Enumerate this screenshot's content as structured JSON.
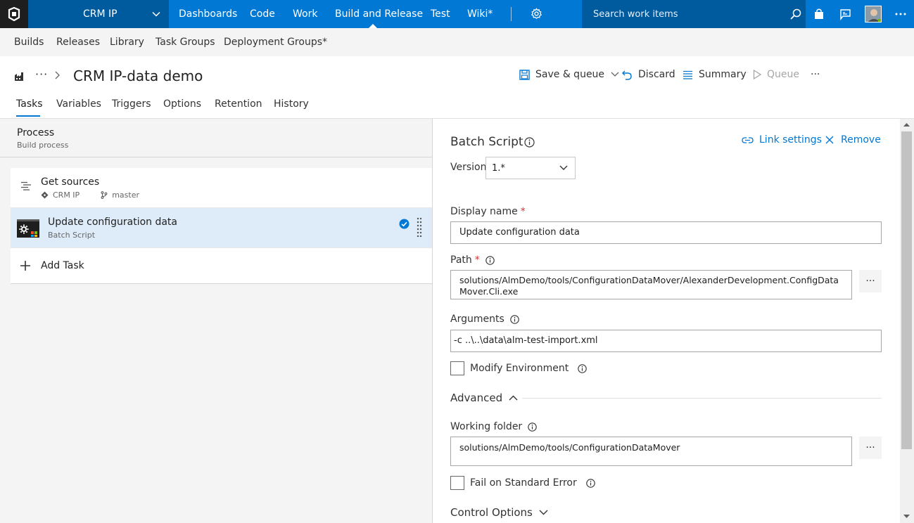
{
  "topbar": {
    "project": "CRM IP",
    "nav": [
      "Dashboards",
      "Code",
      "Work",
      "Build and Release",
      "Test",
      "Wiki*"
    ],
    "active_nav": "Build and Release",
    "search_placeholder": "Search work items"
  },
  "subnav": [
    "Builds",
    "Releases",
    "Library",
    "Task Groups",
    "Deployment Groups*"
  ],
  "header": {
    "breadcrumb_more": "···",
    "title": "CRM IP-data demo",
    "save_queue": "Save & queue",
    "discard": "Discard",
    "summary": "Summary",
    "queue": "Queue",
    "more": "···"
  },
  "tabs": [
    "Tasks",
    "Variables",
    "Triggers",
    "Options",
    "Retention",
    "History"
  ],
  "process": {
    "title": "Process",
    "subtitle": "Build process"
  },
  "tasks": {
    "get_sources": {
      "name": "Get sources",
      "repo": "CRM IP",
      "branch": "master"
    },
    "update_config": {
      "name": "Update configuration data",
      "type": "Batch Script"
    },
    "add_task": "Add Task"
  },
  "details": {
    "title": "Batch Script",
    "link_settings": "Link settings",
    "remove": "Remove",
    "version_label": "Version",
    "version_value": "1.*",
    "display_name_label": "Display name",
    "display_name_value": "Update configuration data",
    "path_label": "Path",
    "path_value": "solutions/AlmDemo/tools/ConfigurationDataMover/AlexanderDevelopment.ConfigDataMover.Cli.exe",
    "arguments_label": "Arguments",
    "arguments_value": "-c ..\\..\\data\\alm-test-import.xml",
    "modify_env_label": "Modify Environment",
    "advanced_label": "Advanced",
    "working_folder_label": "Working folder",
    "working_folder_value": "solutions/AlmDemo/tools/ConfigurationDataMover",
    "fail_stderr_label": "Fail on Standard Error",
    "control_options_label": "Control Options",
    "required_mark": "*",
    "browse": "···"
  },
  "colors": {
    "accent": "#0078d4",
    "topbar_dark": "#005a9e",
    "selected_row": "#deecf9"
  }
}
